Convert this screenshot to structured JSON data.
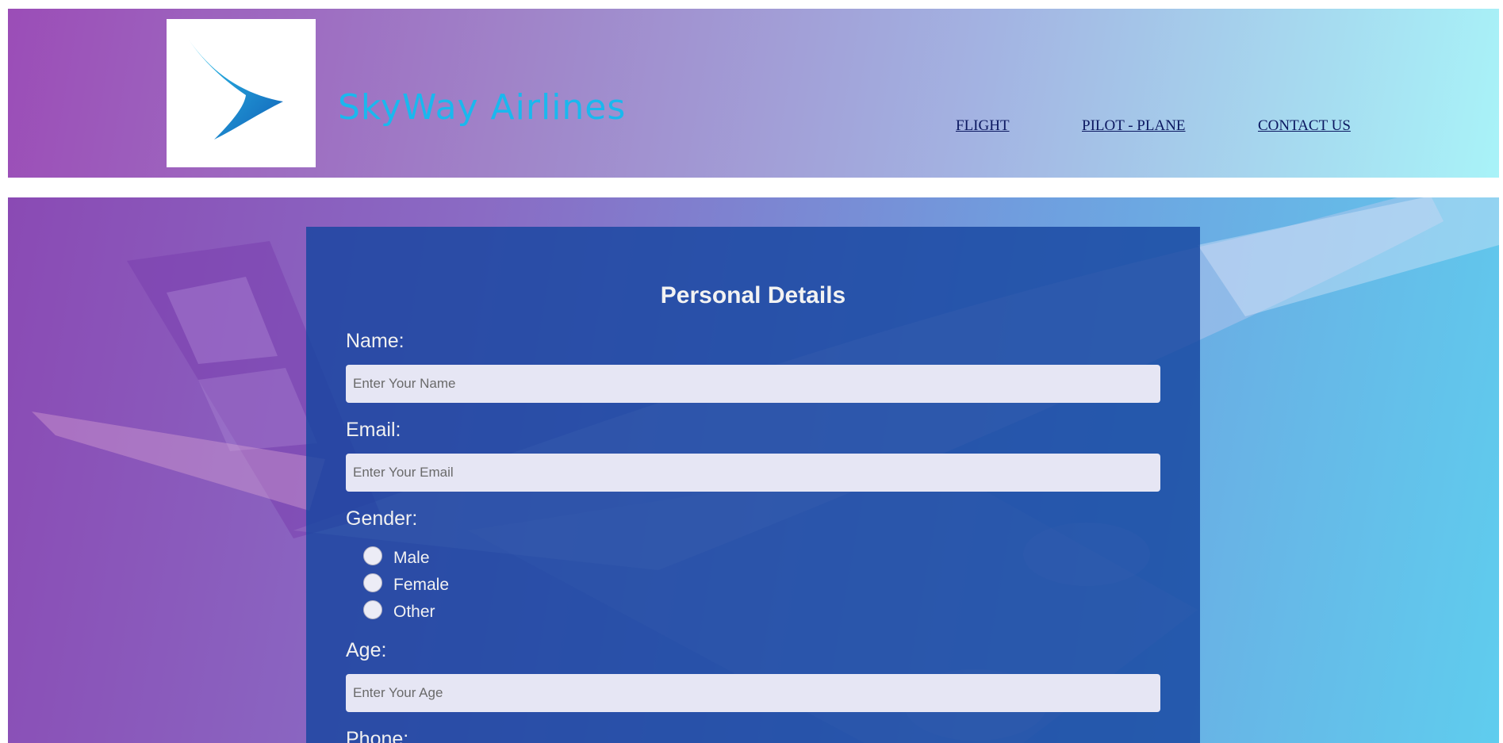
{
  "header": {
    "brand_name": "SkyWay Airlines",
    "nav": [
      {
        "label": "FLIGHT"
      },
      {
        "label": "PILOT - PLANE"
      },
      {
        "label": "CONTACT US"
      }
    ],
    "colors": {
      "brand_text": "#1ab8ee",
      "nav_link": "#0b1760"
    }
  },
  "form": {
    "title": "Personal Details",
    "name": {
      "label": "Name:",
      "placeholder": "Enter Your Name"
    },
    "email": {
      "label": "Email:",
      "placeholder": "Enter Your Email"
    },
    "gender": {
      "label": "Gender:",
      "options": [
        {
          "label": "Male"
        },
        {
          "label": "Female"
        },
        {
          "label": "Other"
        }
      ]
    },
    "age": {
      "label": "Age:",
      "placeholder": "Enter Your Age"
    },
    "phone": {
      "label": "Phone:"
    }
  },
  "icons": {
    "logo": "airline-logo-icon"
  }
}
